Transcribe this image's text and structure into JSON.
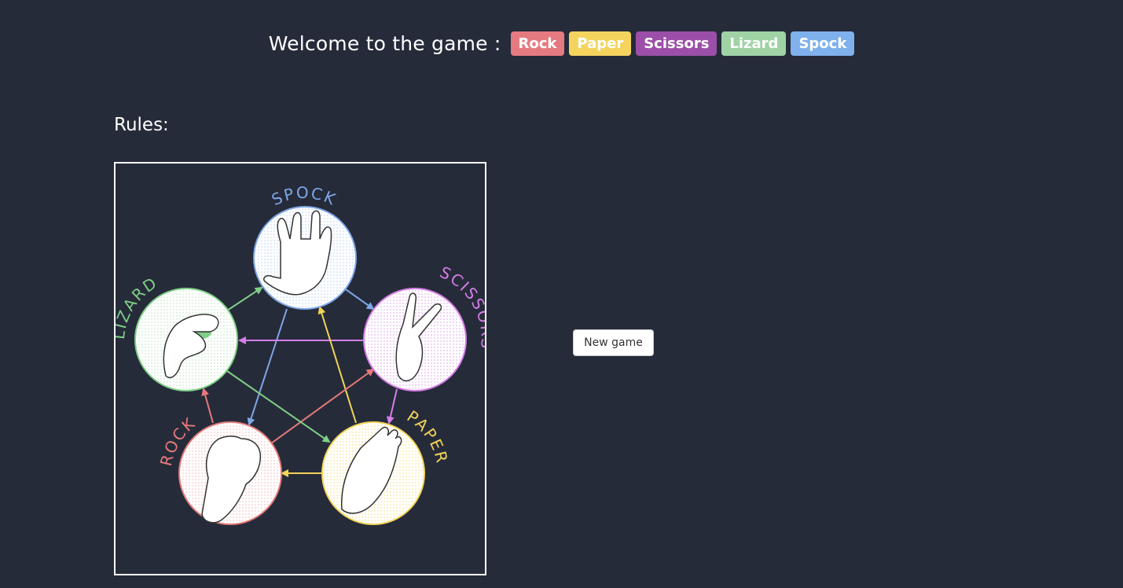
{
  "header": {
    "welcome_text": "Welcome to the game :",
    "choices": [
      {
        "label": "Rock",
        "color": "#e57b81"
      },
      {
        "label": "Paper",
        "color": "#f5d45e"
      },
      {
        "label": "Scissors",
        "color": "#9c4fa8"
      },
      {
        "label": "Lizard",
        "color": "#9fd3a6"
      },
      {
        "label": "Spock",
        "color": "#7fb1ec"
      }
    ]
  },
  "rules": {
    "label": "Rules:",
    "diagram": {
      "spock": {
        "label": "SPOCK",
        "color": "#7fa7e6"
      },
      "scissors": {
        "label": "SCISSORS",
        "color": "#d67ee8"
      },
      "paper": {
        "label": "PAPER",
        "color": "#f2d458"
      },
      "rock": {
        "label": "ROCK",
        "color": "#e67a7a"
      },
      "lizard": {
        "label": "LIZARD",
        "color": "#7fcf86"
      }
    }
  },
  "actions": {
    "new_game_label": "New game"
  }
}
